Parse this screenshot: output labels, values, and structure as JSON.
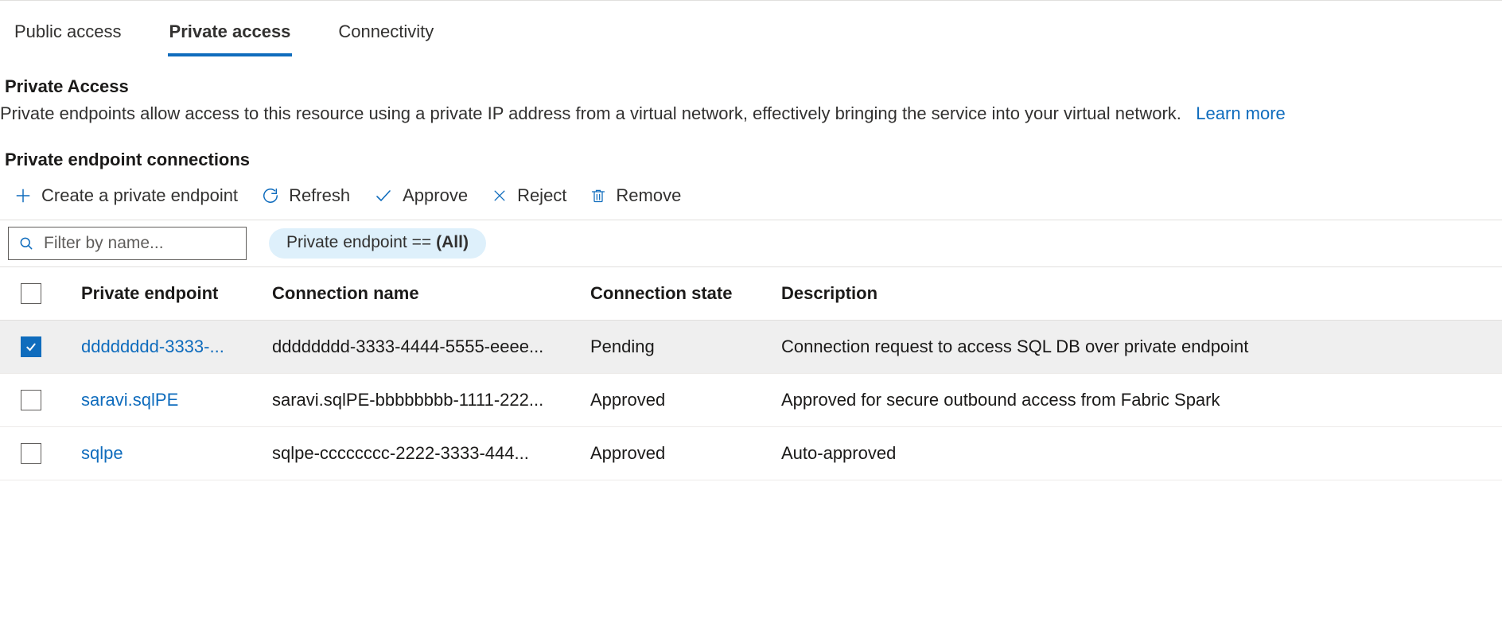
{
  "tabs": [
    {
      "id": "public",
      "label": "Public access",
      "active": false
    },
    {
      "id": "private",
      "label": "Private access",
      "active": true
    },
    {
      "id": "conn",
      "label": "Connectivity",
      "active": false
    }
  ],
  "privateAccess": {
    "title": "Private Access",
    "desc": "Private endpoints allow access to this resource using a private IP address from a virtual network, effectively bringing the service into your virtual network.",
    "learnMore": "Learn more"
  },
  "endpoints": {
    "heading": "Private endpoint connections",
    "toolbar": {
      "create": "Create a private endpoint",
      "refresh": "Refresh",
      "approve": "Approve",
      "reject": "Reject",
      "remove": "Remove"
    },
    "filter": {
      "placeholder": "Filter by name...",
      "pillLabel": "Private endpoint ==",
      "pillValue": "(All)"
    },
    "columns": {
      "endpoint": "Private endpoint",
      "connection": "Connection name",
      "state": "Connection state",
      "desc": "Description"
    },
    "rows": [
      {
        "selected": true,
        "endpoint": "dddddddd-3333-...",
        "connection": "dddddddd-3333-4444-5555-eeee...",
        "state": "Pending",
        "desc": "Connection request to access SQL DB over private endpoint"
      },
      {
        "selected": false,
        "endpoint": "saravi.sqlPE",
        "connection": "saravi.sqlPE-bbbbbbbb-1111-222...",
        "state": "Approved",
        "desc": "Approved for secure outbound access from Fabric Spark"
      },
      {
        "selected": false,
        "endpoint": "sqlpe",
        "connection": "sqlpe-cccccccc-2222-3333-444...",
        "state": "Approved",
        "desc": "Auto-approved"
      }
    ]
  }
}
